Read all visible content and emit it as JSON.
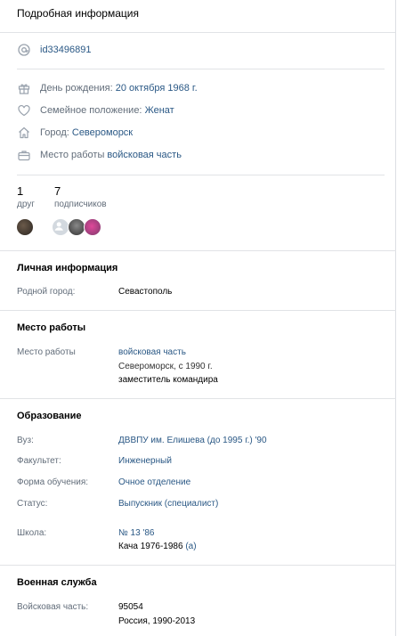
{
  "header": {
    "title": "Подробная информация"
  },
  "profile": {
    "id": "id33496891",
    "birthday_label": "День рождения:",
    "birthday_value": "20 октября 1968 г.",
    "family_label": "Семейное положение:",
    "family_value": "Женат",
    "city_label": "Город:",
    "city_value": "Североморск",
    "work_label": "Место работы",
    "work_value": "войсковая часть"
  },
  "counts": {
    "friends_num": "1",
    "friends_label": "друг",
    "followers_num": "7",
    "followers_label": "подписчиков"
  },
  "personal": {
    "title": "Личная информация",
    "hometown_label": "Родной город:",
    "hometown_value": "Севастополь"
  },
  "work": {
    "title": "Место работы",
    "label": "Место работы",
    "company": "войсковая часть",
    "location": "Североморск, с 1990 г.",
    "position": "заместитель командира"
  },
  "education": {
    "title": "Образование",
    "uni_label": "Вуз:",
    "uni_value": "ДВВПУ им. Елишева (до 1995 г.) '90",
    "faculty_label": "Факультет:",
    "faculty_value": "Инженерный",
    "form_label": "Форма обучения:",
    "form_value": "Очное отделение",
    "status_label": "Статус:",
    "status_value": "Выпускник (специалист)",
    "school_label": "Школа:",
    "school_value": "№ 13 '86",
    "school_detail": "Кача 1976-1986",
    "school_detail_link": "(а)"
  },
  "military": {
    "title": "Военная служба",
    "label": "Войсковая часть:",
    "unit": "95054",
    "period": "Россия, 1990-2013"
  },
  "colors": {
    "link": "#2a5885",
    "muted": "#626d7a",
    "separator": "#e1e3e6"
  }
}
